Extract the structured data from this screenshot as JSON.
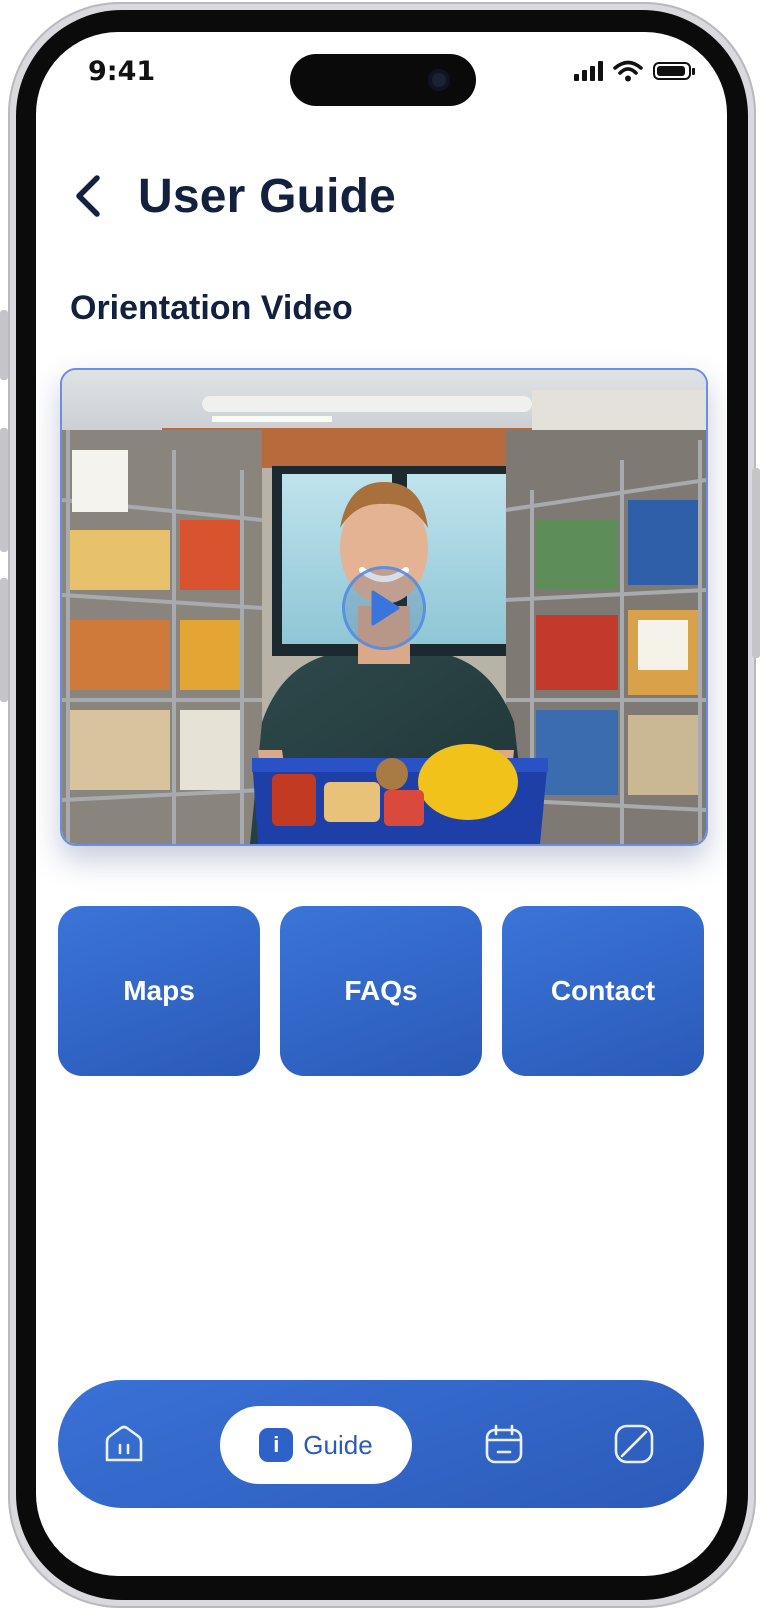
{
  "status_bar": {
    "time": "9:41"
  },
  "header": {
    "title": "User Guide"
  },
  "section": {
    "title": "Orientation Video"
  },
  "tiles": [
    {
      "label": "Maps"
    },
    {
      "label": "FAQs"
    },
    {
      "label": "Contact"
    }
  ],
  "navbar": {
    "items": [
      {
        "icon": "home-icon"
      },
      {
        "icon": "info-icon",
        "label": "Guide",
        "badge": "i",
        "active": true
      },
      {
        "icon": "calendar-icon"
      },
      {
        "icon": "slash-square-icon"
      }
    ]
  },
  "colors": {
    "primary": "#2f62c8",
    "title": "#13213f",
    "background": "#ffffff"
  }
}
